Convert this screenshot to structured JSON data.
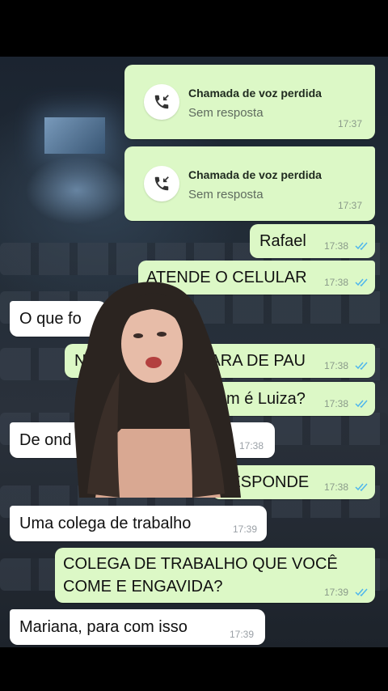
{
  "colors": {
    "outgoing_bubble": "#dcf8c6",
    "incoming_bubble": "#ffffff",
    "read_ticks": "#4fb6ec"
  },
  "missed_calls": [
    {
      "title": "Chamada de voz perdida",
      "subtitle": "Sem resposta",
      "time": "17:37",
      "icon": "missed-call-icon"
    },
    {
      "title": "Chamada de voz perdida",
      "subtitle": "Sem resposta",
      "time": "17:37",
      "icon": "missed-call-icon"
    }
  ],
  "messages": [
    {
      "direction": "out",
      "text": "Rafael",
      "time": "17:38",
      "read": true
    },
    {
      "direction": "out",
      "text": "ATENDE O CELULAR",
      "time": "17:38",
      "read": true
    },
    {
      "direction": "in",
      "text": "O que fo",
      "time": ""
    },
    {
      "direction": "out",
      "text": "N",
      "text2": "CARA DE PAU",
      "time": "17:38",
      "read": true
    },
    {
      "direction": "out",
      "text": "m é Luiza?",
      "time": "17:38",
      "read": true
    },
    {
      "direction": "in",
      "text": "De ond",
      "time": "17:38"
    },
    {
      "direction": "out",
      "text": "RESPONDE",
      "time": "17:38",
      "read": true
    },
    {
      "direction": "in",
      "text": "Uma colega de trabalho",
      "time": "17:39"
    },
    {
      "direction": "out",
      "text": "COLEGA DE TRABALHO QUE VOCÊ",
      "text2": "COME E ENGAVIDA?",
      "time": "17:39",
      "read": true
    },
    {
      "direction": "in",
      "text": "Mariana, para com isso",
      "time": "17:39"
    }
  ]
}
